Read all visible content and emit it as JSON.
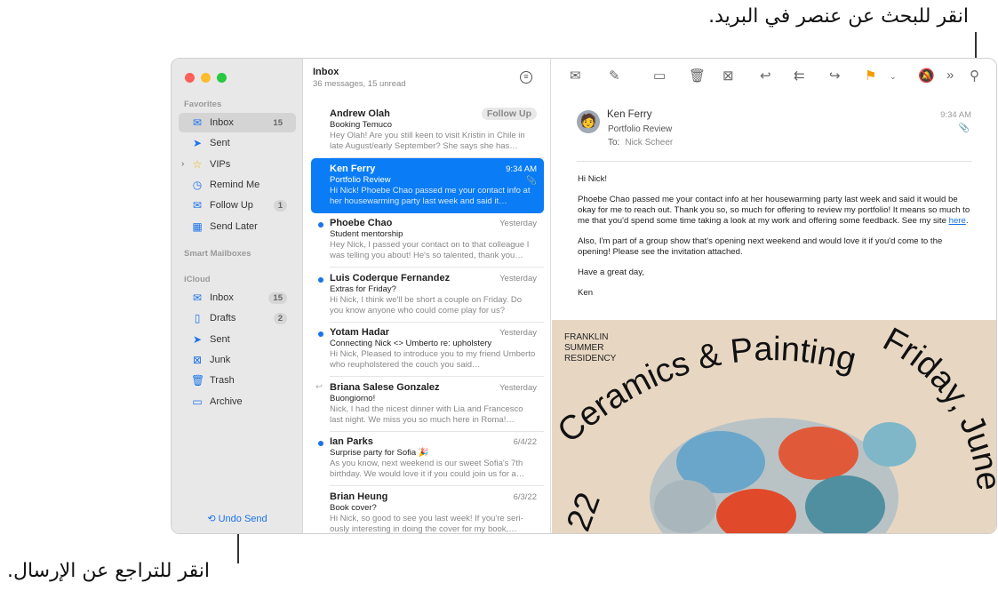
{
  "callouts": {
    "search": "انقر للبحث عن عنصر في البريد.",
    "undo": "انقر للتراجع عن الإرسال."
  },
  "sidebar": {
    "favorites_label": "Favorites",
    "favorites": [
      {
        "label": "Inbox",
        "icon": "tray-icon",
        "count": "15"
      },
      {
        "label": "Sent",
        "icon": "paperplane-icon"
      },
      {
        "label": "VIPs",
        "icon": "star-icon"
      },
      {
        "label": "Remind Me",
        "icon": "clock-icon"
      },
      {
        "label": "Follow Up",
        "icon": "follow-up-icon",
        "count": "1"
      },
      {
        "label": "Send Later",
        "icon": "calendar-icon"
      }
    ],
    "smart_label": "Smart Mailboxes",
    "icloud_label": "iCloud",
    "icloud": [
      {
        "label": "Inbox",
        "icon": "tray-icon",
        "count": "15"
      },
      {
        "label": "Drafts",
        "icon": "doc-icon",
        "count": "2"
      },
      {
        "label": "Sent",
        "icon": "paperplane-icon"
      },
      {
        "label": "Junk",
        "icon": "junk-icon"
      },
      {
        "label": "Trash",
        "icon": "trash-icon"
      },
      {
        "label": "Archive",
        "icon": "archive-icon"
      }
    ],
    "undo_send": "Undo Send"
  },
  "list": {
    "title": "Inbox",
    "subtitle": "36 messages, 15 unread",
    "messages": [
      {
        "from": "Andrew Olah",
        "subject": "Booking Temuco",
        "preview": "Hey Olah! Are you still keen to visit Kristin in Chile in late August/early September? She says she has…",
        "badge": "Follow Up"
      },
      {
        "from": "Ken Ferry",
        "subject": "Portfolio Review",
        "preview": "Hi Nick! Phoebe Chao passed me your contact info at her housewarming party last week and said it…",
        "date": "9:34 AM",
        "selected": true
      },
      {
        "from": "Phoebe Chao",
        "subject": "Student mentorship",
        "preview": "Hey Nick, I passed your contact on to that colleague I was telling you about! He's so talented, thank you…",
        "date": "Yesterday",
        "unread": true
      },
      {
        "from": "Luis Coderque Fernandez",
        "subject": "Extras for Friday?",
        "preview": "Hi Nick, I think we'll be short a couple on Friday. Do you know anyone who could come play for us?",
        "date": "Yesterday",
        "unread": true
      },
      {
        "from": "Yotam Hadar",
        "subject": "Connecting Nick <> Umberto re: upholstery",
        "preview": "Hi Nick, Pleased to introduce you to my friend Umberto who reupholstered the couch you said…",
        "date": "Yesterday",
        "unread": true
      },
      {
        "from": "Briana Salese Gonzalez",
        "subject": "Buongiorno!",
        "preview": "Nick, I had the nicest dinner with Lia and Francesco last night. We miss you so much here in Roma!…",
        "date": "Yesterday",
        "replied": true
      },
      {
        "from": "Ian Parks",
        "subject": "Surprise party for Sofia 🎉",
        "preview": "As you know, next weekend is our sweet Sofia's 7th birthday. We would love it if you could join us for a…",
        "date": "6/4/22",
        "unread": true
      },
      {
        "from": "Brian Heung",
        "subject": "Book cover?",
        "preview": "Hi Nick, so good to see you last week! If you're seri-ously interesting in doing the cover for my book,…",
        "date": "6/3/22"
      }
    ]
  },
  "detail": {
    "from": "Ken Ferry",
    "subject": "Portfolio Review",
    "to_label": "To:",
    "to": "Nick Scheer",
    "time": "9:34 AM",
    "body": {
      "greeting": "Hi Nick!",
      "p1": "Phoebe Chao passed me your contact info at her housewarming party last week and said it would be okay for me to reach out. Thank you so, so much for offering to review my portfolio! It means so much to me that you'd spend some time taking a look at my work and offering some feedback. See my site ",
      "link": "here",
      "p1_end": ".",
      "p2": "Also, I'm part of a group show that's opening next weekend and would love it if you'd come to the opening! Please see the invitation attached.",
      "p3": "Have a great day,",
      "sign": "Ken"
    },
    "poster": {
      "l1": "FRANKLIN",
      "l2": "SUMMER",
      "l3": "RESIDENCY",
      "arc": "Ceramics & Painting",
      "side": "Friday, June",
      "num": "22"
    }
  },
  "colors": {
    "accent": "#0a7cf5",
    "flag": "#f59b00"
  }
}
